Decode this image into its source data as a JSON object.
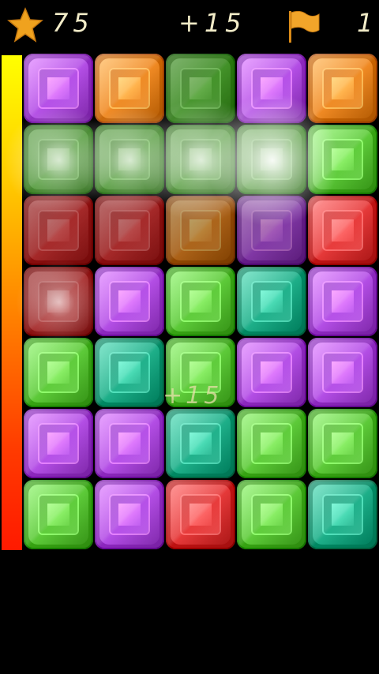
{
  "hud": {
    "score_icon": "star-icon",
    "score": "75",
    "bonus": "+15",
    "level_icon": "flag-icon",
    "level": "1"
  },
  "floating_score": "+15",
  "colors": {
    "purple": "#b44fe6",
    "orange": "#f08a24",
    "green": "#5ecb3a",
    "red": "#e63a3a",
    "teal": "#1fb08a"
  },
  "board": {
    "rows": [
      [
        "purple",
        "orange",
        "green",
        "purple",
        "orange"
      ],
      [
        "green",
        "green",
        "green",
        "green",
        "green"
      ],
      [
        "red",
        "red",
        "orange",
        "purple",
        "red"
      ],
      [
        "red",
        "purple",
        "green",
        "teal",
        "purple"
      ],
      [
        "green",
        "teal",
        "green",
        "purple",
        "purple"
      ],
      [
        "purple",
        "purple",
        "teal",
        "green",
        "green"
      ],
      [
        "green",
        "purple",
        "red",
        "green",
        "teal"
      ]
    ],
    "faded_cells": [
      "1-0",
      "1-1",
      "1-2",
      "1-3",
      "0-2",
      "2-0",
      "2-1",
      "2-2",
      "2-3",
      "3-0"
    ]
  }
}
